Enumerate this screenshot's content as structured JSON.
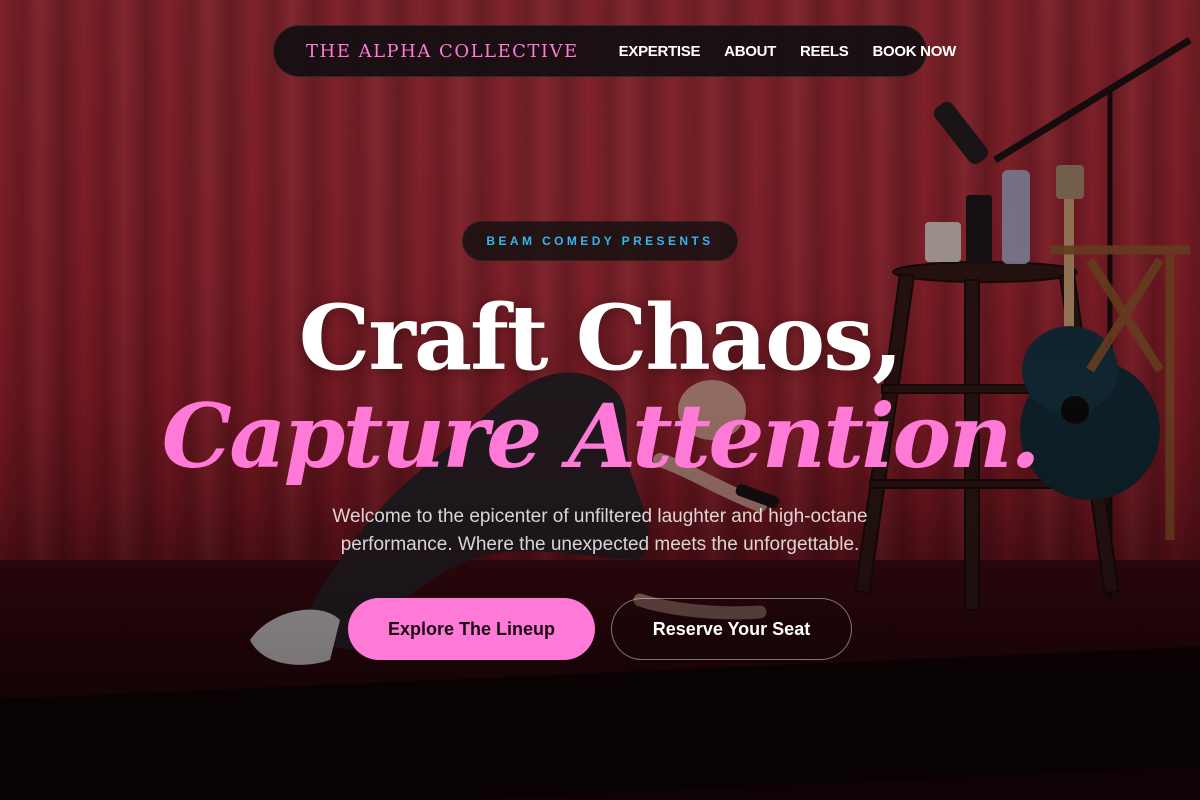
{
  "nav": {
    "brand": "THE ALPHA COLLECTIVE",
    "links": [
      {
        "label": "EXPERTISE"
      },
      {
        "label": "ABOUT"
      },
      {
        "label": "REELS"
      },
      {
        "label": "BOOK NOW"
      }
    ]
  },
  "hero": {
    "eyebrow": "BEAM COMEDY PRESENTS",
    "headline_line1": "Craft Chaos,",
    "headline_line2": "Capture Attention.",
    "subtext": "Welcome to the epicenter of unfiltered laughter and high-octane performance. Where the unexpected meets the unforgettable.",
    "primary_cta": "Explore The Lineup",
    "secondary_cta": "Reserve Your Seat"
  },
  "colors": {
    "accent_pink": "#ff79d6",
    "eyebrow_blue": "#34b6ea",
    "nav_bg": "#120e10",
    "curtain_red": "#a82632"
  },
  "background": {
    "icons": [
      "stage-curtain",
      "microphone-stand-icon",
      "bar-stool-icon",
      "acoustic-guitar-icon",
      "performer-figure"
    ]
  }
}
